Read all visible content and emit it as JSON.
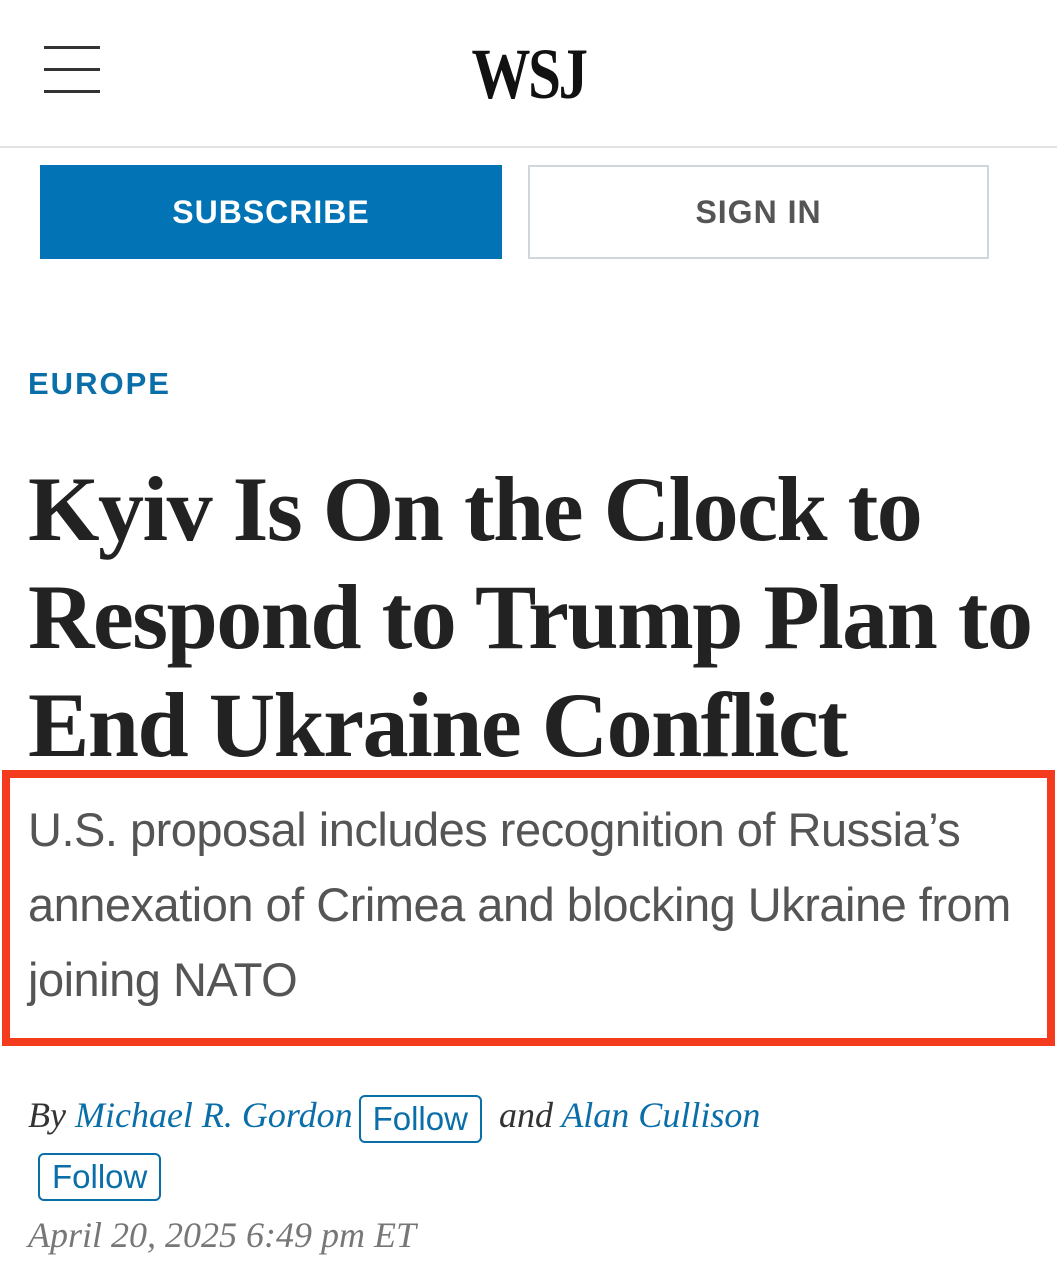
{
  "header": {
    "logo_text": "WSJ",
    "menu_icon": "hamburger-menu-icon"
  },
  "auth": {
    "subscribe_label": "SUBSCRIBE",
    "signin_label": "SIGN IN"
  },
  "article": {
    "section": "EUROPE",
    "headline": "Kyiv Is On the Clock to Respond to Trump Plan to End Ukraine Conflict",
    "dek": "U.S. proposal includes recognition of Russia’s annexation of Crimea and blocking Ukraine from joining NATO",
    "byline": {
      "prefix": "By",
      "author1": "Michael R. Gordon",
      "follow1": "Follow",
      "conjunction": "and",
      "author2": "Alan Cullison",
      "follow2": "Follow"
    },
    "date": "April 20, 2025 6:49 pm ET"
  },
  "colors": {
    "accent": "#0274b6",
    "highlight_border": "#f53b1e"
  }
}
